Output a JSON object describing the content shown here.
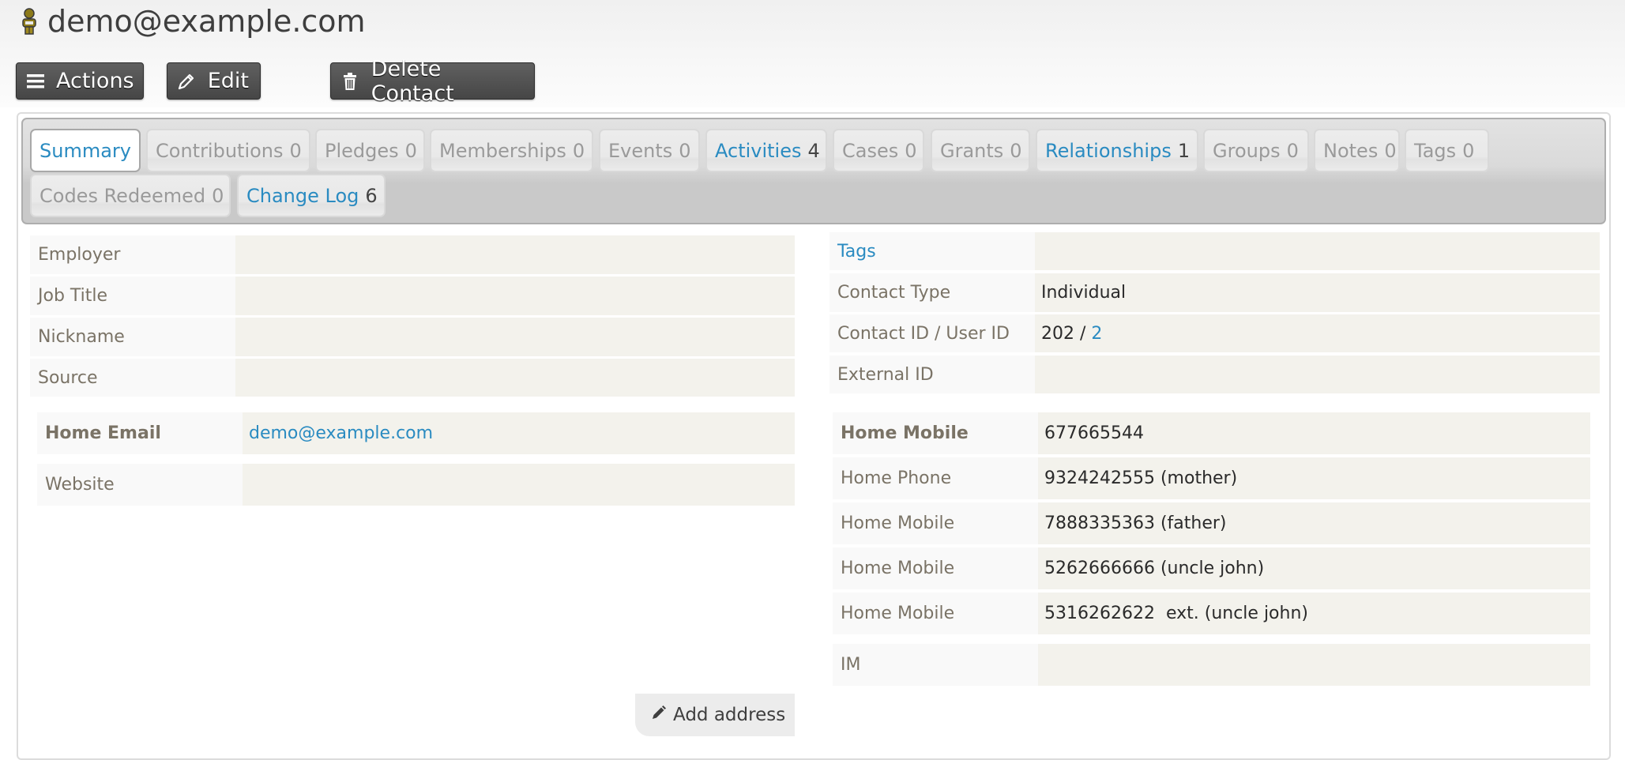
{
  "header": {
    "title": "demo@example.com",
    "contact_icon": "person-icon"
  },
  "toolbar": {
    "actions_label": "Actions",
    "actions_icon": "hamburger-menu-icon",
    "edit_label": "Edit",
    "edit_icon": "pencil-icon",
    "delete_label": "Delete Contact",
    "delete_icon": "trash-icon"
  },
  "tabs": [
    {
      "label": "Summary",
      "count": "",
      "active": true,
      "has_items": false
    },
    {
      "label": "Contributions",
      "count": "0",
      "active": false,
      "has_items": false
    },
    {
      "label": "Pledges",
      "count": "0",
      "active": false,
      "has_items": false
    },
    {
      "label": "Memberships",
      "count": "0",
      "active": false,
      "has_items": false
    },
    {
      "label": "Events",
      "count": "0",
      "active": false,
      "has_items": false
    },
    {
      "label": "Activities",
      "count": "4",
      "active": false,
      "has_items": true
    },
    {
      "label": "Cases",
      "count": "0",
      "active": false,
      "has_items": false
    },
    {
      "label": "Grants",
      "count": "0",
      "active": false,
      "has_items": false
    },
    {
      "label": "Relationships",
      "count": "1",
      "active": false,
      "has_items": true
    },
    {
      "label": "Groups",
      "count": "0",
      "active": false,
      "has_items": false
    },
    {
      "label": "Notes",
      "count": "0",
      "active": false,
      "has_items": false
    },
    {
      "label": "Tags",
      "count": "0",
      "active": false,
      "has_items": false
    },
    {
      "label": "Codes Redeemed",
      "count": "0",
      "active": false,
      "has_items": false
    },
    {
      "label": "Change Log",
      "count": "6",
      "active": false,
      "has_items": true
    }
  ],
  "left_info": [
    {
      "label": "Employer",
      "value": ""
    },
    {
      "label": "Job Title",
      "value": ""
    },
    {
      "label": "Nickname",
      "value": ""
    },
    {
      "label": "Source",
      "value": ""
    }
  ],
  "right_info": {
    "tags_label": "Tags",
    "tags_value": "",
    "contact_type_label": "Contact Type",
    "contact_type_value": "Individual",
    "contact_id_label": "Contact ID / User ID",
    "contact_id": "202",
    "id_separator": " / ",
    "user_id": "2",
    "external_id_label": "External ID",
    "external_id_value": ""
  },
  "email": {
    "label": "Home Email",
    "value": "demo@example.com",
    "website_label": "Website",
    "website_value": ""
  },
  "phones": [
    {
      "label": "Home Mobile",
      "value": "677665544",
      "primary": true
    },
    {
      "label": "Home Phone",
      "value": "9324242555 (mother)",
      "primary": false
    },
    {
      "label": "Home Mobile",
      "value": "7888335363 (father)",
      "primary": false
    },
    {
      "label": "Home Mobile",
      "value": "5262666666 (uncle john)",
      "primary": false
    },
    {
      "label": "Home Mobile",
      "value": "5316262622  ext. (uncle john)",
      "primary": false
    }
  ],
  "im": {
    "label": "IM",
    "value": ""
  },
  "address": {
    "add_label": "Add address",
    "add_icon": "pencil-icon"
  }
}
